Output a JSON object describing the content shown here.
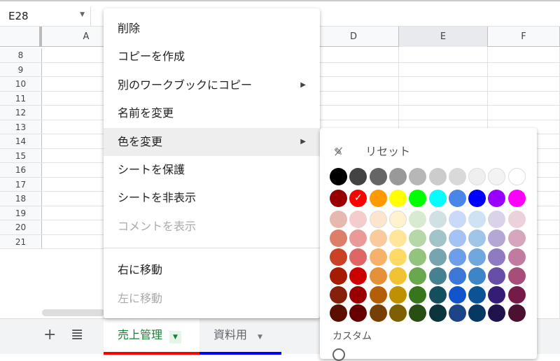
{
  "name_box": "E28",
  "columns": [
    {
      "label": "A",
      "l": 60,
      "w": 127
    },
    {
      "label": "",
      "l": 187,
      "w": 127
    },
    {
      "label": "",
      "l": 314,
      "w": 127
    },
    {
      "label": "D",
      "l": 441,
      "w": 129
    },
    {
      "label": "E",
      "l": 570,
      "w": 127
    },
    {
      "label": "F",
      "l": 697,
      "w": 103
    }
  ],
  "rows": [
    "8",
    "9",
    "10",
    "11",
    "12",
    "13",
    "14",
    "15",
    "16",
    "17",
    "18",
    "19",
    "20",
    "21"
  ],
  "menu": {
    "items": [
      {
        "label": "削除",
        "disabled": false
      },
      {
        "label": "コピーを作成",
        "disabled": false
      },
      {
        "label": "別のワークブックにコピー",
        "submenu": true
      },
      {
        "label": "名前を変更"
      },
      {
        "label": "色を変更",
        "submenu": true,
        "highlighted": true
      },
      {
        "label": "シートを保護"
      },
      {
        "label": "シートを非表示"
      },
      {
        "label": "コメントを表示",
        "disabled": true
      },
      {
        "label": "右に移動",
        "after_divider": true
      },
      {
        "label": "左に移動",
        "disabled": true
      }
    ]
  },
  "palette": {
    "reset_label": "リセット",
    "custom_label": "カスタム",
    "selected": "#ff0000",
    "rows": [
      [
        "#000000",
        "#434343",
        "#666666",
        "#999999",
        "#b7b7b7",
        "#cccccc",
        "#d9d9d9",
        "#efefef",
        "#f3f3f3",
        "#ffffff"
      ],
      [
        "#980000",
        "#ff0000",
        "#ff9900",
        "#ffff00",
        "#00ff00",
        "#00ffff",
        "#4a86e8",
        "#0000ff",
        "#9900ff",
        "#ff00ff"
      ],
      [
        "#e6b8af",
        "#f4cccc",
        "#fce5cd",
        "#fff2cc",
        "#d9ead3",
        "#d0e0e3",
        "#c9daf8",
        "#cfe2f3",
        "#d9d2e9",
        "#ead1dc"
      ],
      [
        "#dd7e6b",
        "#ea9999",
        "#f9cb9c",
        "#ffe599",
        "#b6d7a8",
        "#a2c4c9",
        "#a4c2f4",
        "#9fc5e8",
        "#b4a7d6",
        "#d5a6bd"
      ],
      [
        "#cc4125",
        "#e06666",
        "#f6b26b",
        "#ffd966",
        "#93c47d",
        "#76a5af",
        "#6d9eeb",
        "#6fa8dc",
        "#8e7cc3",
        "#c27ba0"
      ],
      [
        "#a61c00",
        "#cc0000",
        "#e69138",
        "#f1c232",
        "#6aa84f",
        "#45818e",
        "#3c78d8",
        "#3d85c6",
        "#674ea7",
        "#a64d79"
      ],
      [
        "#85200c",
        "#990000",
        "#b45f06",
        "#bf9000",
        "#38761d",
        "#134f5c",
        "#1155cc",
        "#0b5394",
        "#351c75",
        "#741b47"
      ],
      [
        "#5b0f00",
        "#660000",
        "#783f04",
        "#7f6000",
        "#274e13",
        "#0c343d",
        "#1c4587",
        "#073763",
        "#20124d",
        "#4c1130"
      ]
    ]
  },
  "sheets": [
    {
      "name": "売上管理",
      "active": true,
      "color": "#ff0000"
    },
    {
      "name": "資料用",
      "active": false,
      "color": "#0000ff"
    }
  ],
  "add_sheet": "+",
  "all_sheets": "≣"
}
